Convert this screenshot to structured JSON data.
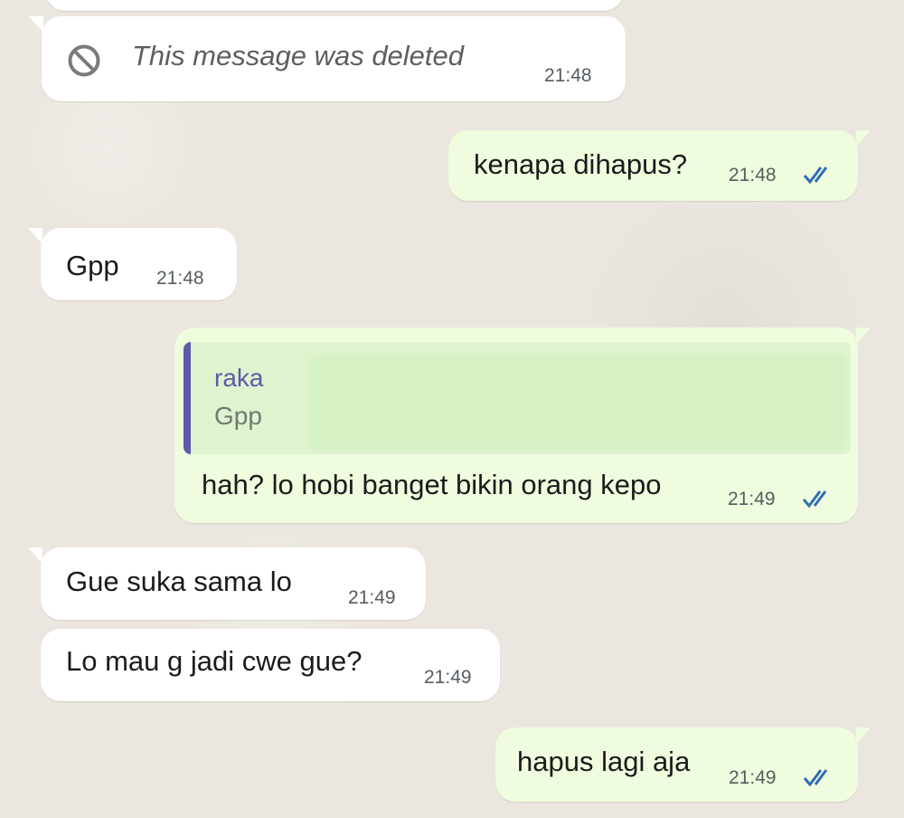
{
  "colors": {
    "incoming_bubble": "#ffffff",
    "outgoing_bubble": "#effdde",
    "quote_accent": "#5e5aa8",
    "read_ticks": "#2f6cb3"
  },
  "messages": [
    {
      "direction": "incoming",
      "deleted": true,
      "icon": "ban-icon",
      "text": "This message was deleted",
      "time": "21:48"
    },
    {
      "direction": "outgoing",
      "text": "kenapa dihapus?",
      "time": "21:48",
      "status_icon": "double-check-icon"
    },
    {
      "direction": "incoming",
      "text": "Gpp",
      "time": "21:48"
    },
    {
      "direction": "outgoing",
      "reply_to": {
        "name": "raka",
        "text": "Gpp"
      },
      "text": "hah? lo hobi banget bikin orang kepo",
      "time": "21:49",
      "status_icon": "double-check-icon"
    },
    {
      "direction": "incoming",
      "text": "Gue suka sama lo",
      "time": "21:49"
    },
    {
      "direction": "incoming",
      "text": "Lo mau g jadi cwe gue?",
      "time": "21:49"
    },
    {
      "direction": "outgoing",
      "text": "hapus lagi aja",
      "time": "21:49",
      "status_icon": "double-check-icon"
    }
  ]
}
